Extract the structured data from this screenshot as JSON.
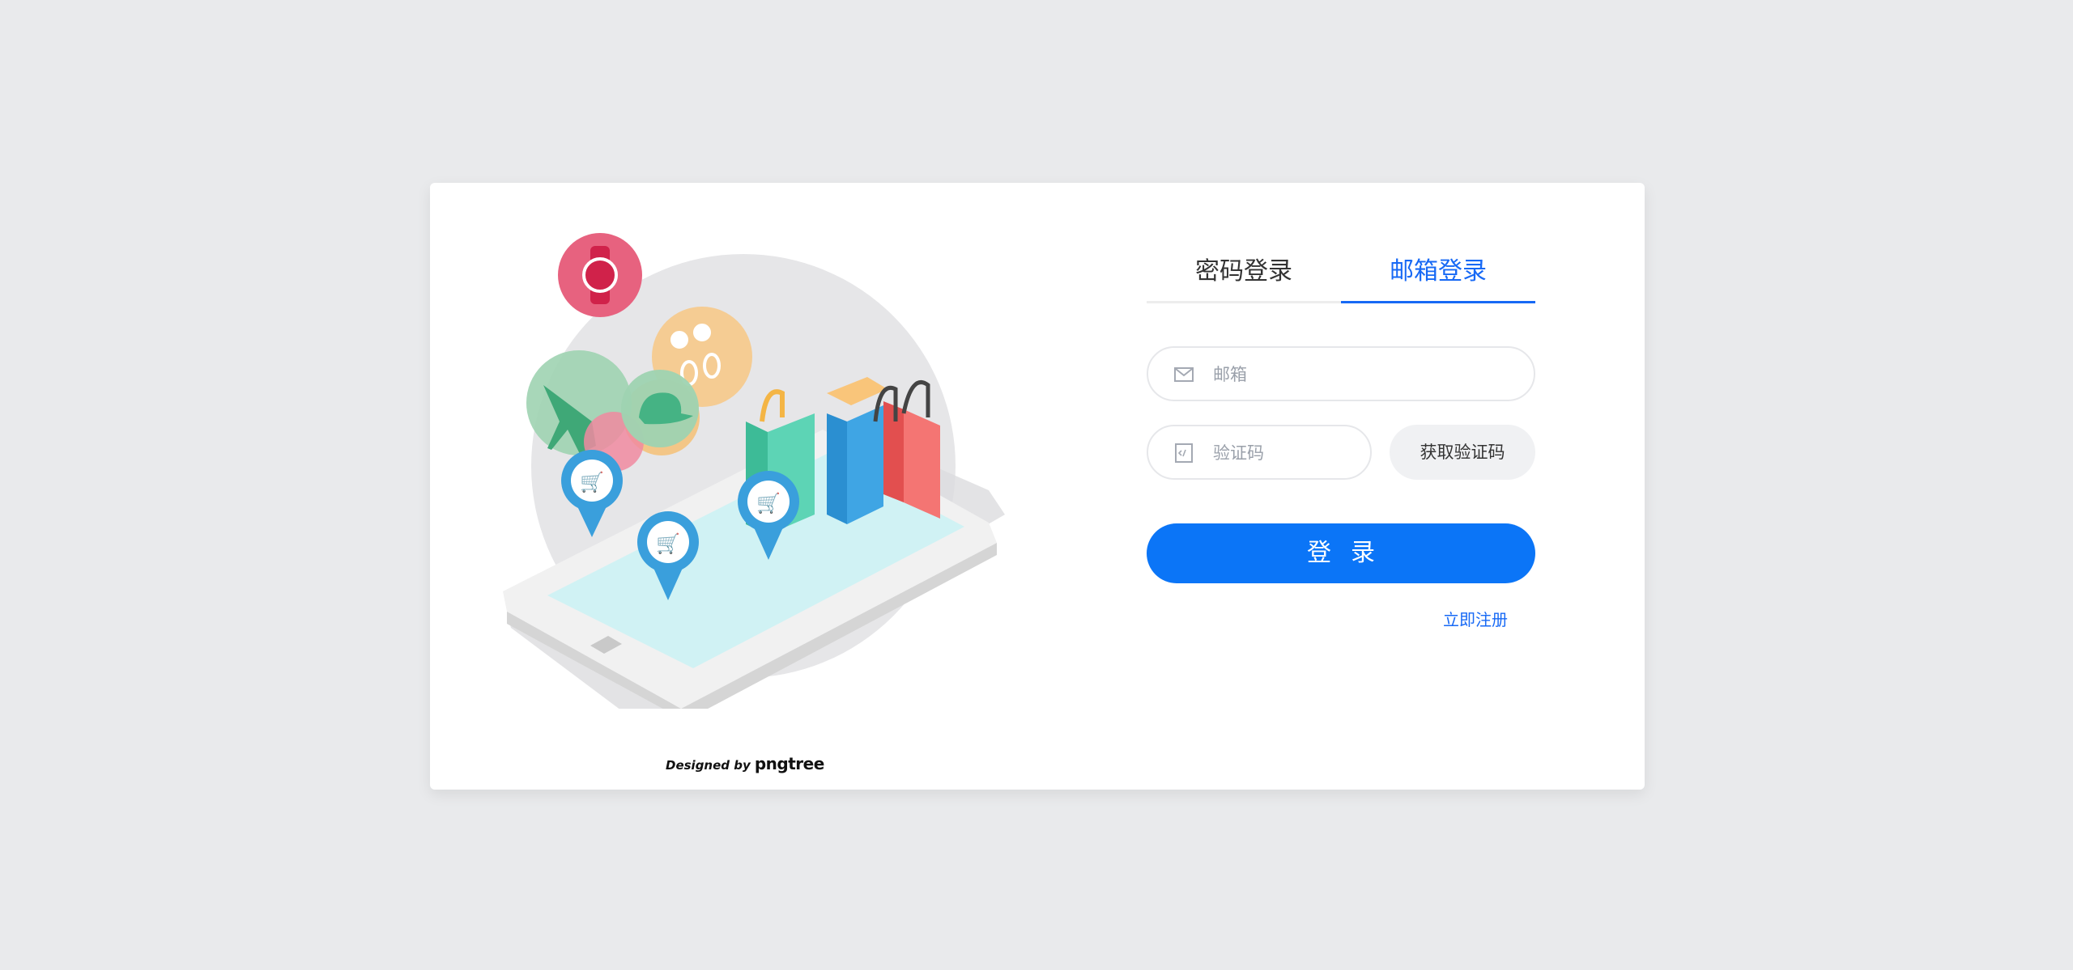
{
  "credit": {
    "designed_by": "Designed by",
    "brand": "pngtree"
  },
  "tabs": [
    {
      "label": "密码登录",
      "active": false
    },
    {
      "label": "邮箱登录",
      "active": true
    }
  ],
  "form": {
    "email_placeholder": "邮箱",
    "code_placeholder": "验证码",
    "get_code_label": "获取验证码",
    "login_label": "登录",
    "register_label": "立即注册"
  },
  "icons": {
    "email": "mail-icon",
    "code": "code-icon"
  },
  "colors": {
    "accent": "#1769f5",
    "button": "#0b75f7",
    "page_bg": "#e9eaec",
    "card_bg": "#ffffff"
  }
}
